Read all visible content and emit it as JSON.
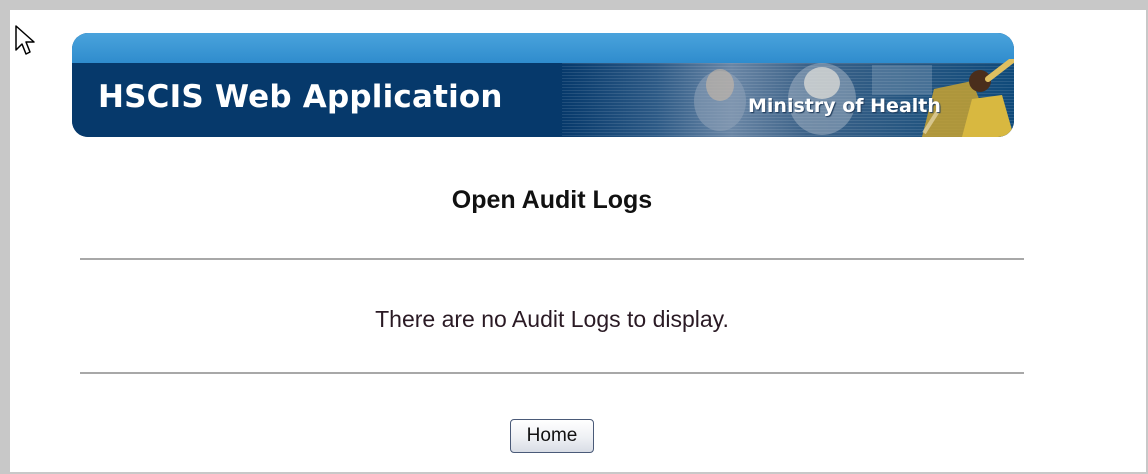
{
  "banner": {
    "app_title": "HSCIS Web Application",
    "ministry_text": "Ministry of Health",
    "colors": {
      "top_band": "#3b98d6",
      "main_band": "#06396b"
    }
  },
  "main": {
    "title": "Open Audit Logs",
    "message": "There are no Audit Logs to display.",
    "home_button_label": "Home"
  },
  "icons": {
    "cursor": "arrow-cursor-icon"
  }
}
